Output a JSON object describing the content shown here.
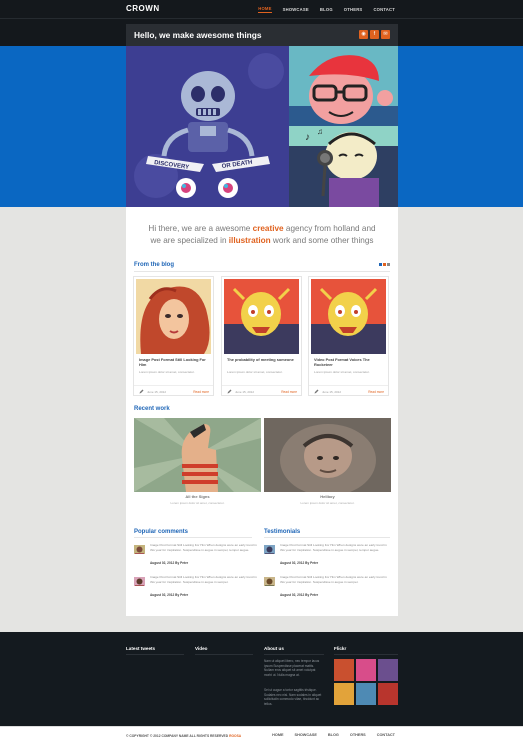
{
  "header": {
    "logo": "CROWN",
    "nav": [
      "HOME",
      "SHOWCASE",
      "BLOG",
      "OTHERS",
      "CONTACT"
    ],
    "active_nav": "HOME",
    "tagline": "Hello, we make awesome things",
    "social": [
      "rss-icon",
      "facebook-icon",
      "email-icon"
    ]
  },
  "hero": {
    "banner_text": [
      "DISCOVERY",
      "OR DEATH"
    ]
  },
  "intro": {
    "line1_pre": "Hi there, we are a awesome ",
    "line1_em": "creative",
    "line1_post": " agency from holland and",
    "line2_pre": "we are specialized in ",
    "line2_em": "illustration",
    "line2_post": " work and some other things"
  },
  "blog": {
    "title": "From the blog",
    "posts": [
      {
        "title": "Image Post Format Still Looking For Him",
        "excerpt": "Lorem ipsum dolor sit amet, consectetur.",
        "date": "June 15, 2012",
        "more": "Read more"
      },
      {
        "title": "The probability of meeting someone",
        "excerpt": "Lorem ipsum dolor sit amet, consectetur.",
        "date": "June 15, 2012",
        "more": "Read more"
      },
      {
        "title": "Video Post Format Voices The Rocketeer",
        "excerpt": "Lorem ipsum dolor sit amet, consectetur.",
        "date": "June 15, 2012",
        "more": "Read more"
      }
    ]
  },
  "work": {
    "title": "Recent work",
    "items": [
      {
        "title": "All the Signs",
        "subtitle": "Lorem ipsum dolor sit amet, consectetur."
      },
      {
        "title": "Hellboy",
        "subtitle": "Lorem ipsum dolor sit amet, consectetur."
      }
    ]
  },
  "comments": {
    "title": "Popular comments",
    "items": [
      {
        "text": "Image Post Format Still Looking For Him When designs were an early trend in this year for inspiration. Suspendisse in augue in semper, tempor augue.",
        "meta": "August 02, 2012 By Peter"
      },
      {
        "text": "Image Post Format Still Looking For Him When designs were an early trend in this year for inspiration. Suspendisse in augue in semper.",
        "meta": "August 02, 2012 By Peter"
      }
    ]
  },
  "testimonials": {
    "title": "Testimonials",
    "items": [
      {
        "text": "Image Post Format Still Looking For Him When designs were an early trend in this year for inspiration. Suspendisse in augue in semper, tempor augue.",
        "meta": "August 02, 2012 By Peter"
      },
      {
        "text": "Image Post Format Still Looking For Him When designs were an early trend in this year for inspiration. Suspendisse in augue in semper.",
        "meta": "August 02, 2012 By Peter"
      }
    ]
  },
  "footer": {
    "tweets_title": "Latest tweets",
    "video_title": "Video",
    "about_title": "About us",
    "about_text": "Nam ut aliquet libero, nec tempor lacus ipsum Suspendisse placerat mattis. Nullam eros aliquet sit amet volutpat morbi ut. Nulla magna at.",
    "about_text2": "Sei ut augue a tortor sagittis tristique. Sodales nec nisi. Nam sodales in aliquet sollicitudin commodo vitae, tincidunt ac tellus.",
    "flickr_title": "Flickr",
    "copyright_pre": "© COPYRIGHT © 2012 COMPANY NAME ALL RIGHTS RESERVED ",
    "copyright_em": "ROOSA",
    "nav": [
      "HOME",
      "SHOWCASE",
      "BLOG",
      "OTHERS",
      "CONTACT"
    ]
  },
  "colors": {
    "accent": "#e0621f",
    "link_blue": "#1f66b7",
    "hero_blue": "#0a67c2",
    "dark": "#14181c"
  }
}
